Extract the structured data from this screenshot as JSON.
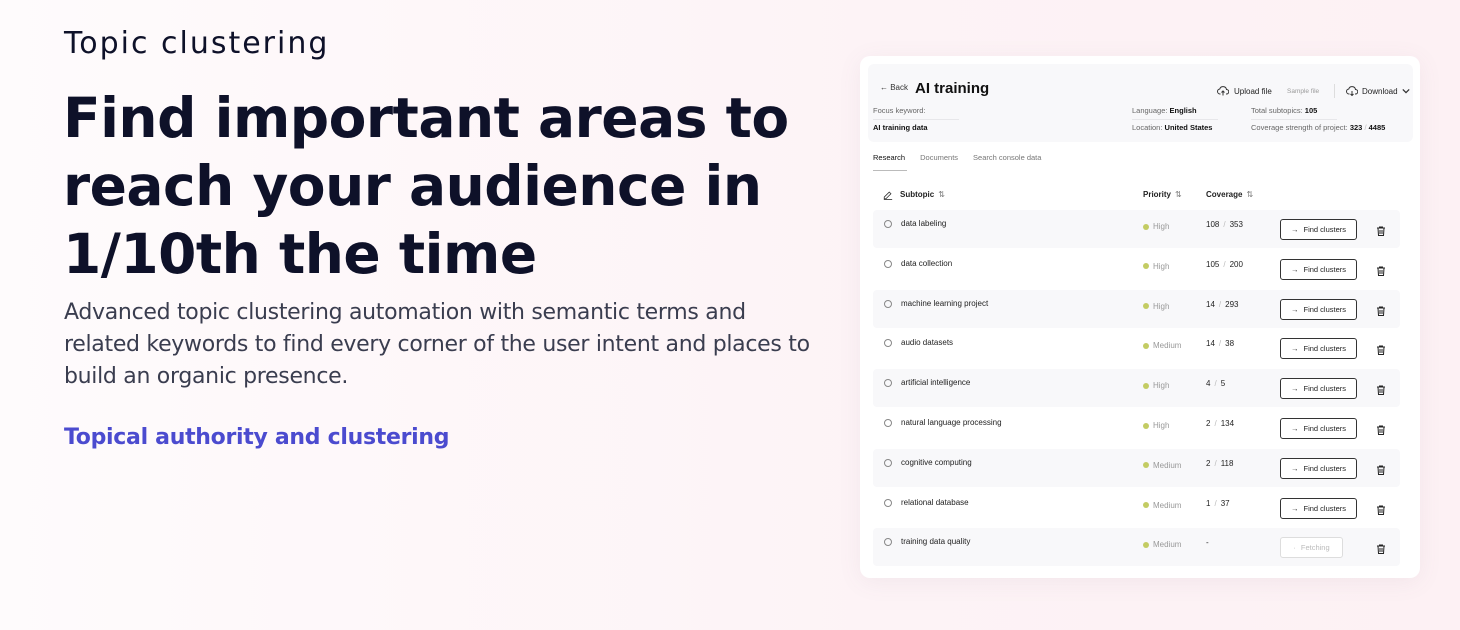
{
  "hero": {
    "eyebrow": "Topic clustering",
    "headline": "Find important areas to reach your audience in 1/10th the time",
    "description": "Advanced topic clustering automation with semantic terms and related keywords to find every corner of the user intent and places to build an organic presence.",
    "link_label": "Topical authority and clustering",
    "link_color": "#4b4bcf"
  },
  "panel": {
    "back_label": "← Back",
    "title": "AI training",
    "upload_label": "Upload file",
    "sample_label": "Sample file",
    "download_label": "Download",
    "focus_keyword_label": "Focus keyword:",
    "focus_keyword_value": "AI training data",
    "language_label": "Language:",
    "language_value": "English",
    "location_label": "Location:",
    "location_value": "United States",
    "total_subtopics_label": "Total subtopics:",
    "total_subtopics_value": "105",
    "coverage_label": "Coverage strength of project:",
    "coverage_value_a": "323",
    "coverage_value_b": "4485",
    "tabs": [
      "Research",
      "Documents",
      "Search console data"
    ],
    "columns": {
      "subtopic": "Subtopic",
      "priority": "Priority",
      "coverage": "Coverage"
    },
    "find_label": "Find clusters",
    "fetching_label": "Fetching",
    "rows": [
      {
        "name": "data labeling",
        "priority": "High",
        "cov_a": "108",
        "cov_b": "353"
      },
      {
        "name": "data collection",
        "priority": "High",
        "cov_a": "105",
        "cov_b": "200"
      },
      {
        "name": "machine learning project",
        "priority": "High",
        "cov_a": "14",
        "cov_b": "293"
      },
      {
        "name": "audio datasets",
        "priority": "Medium",
        "cov_a": "14",
        "cov_b": "38"
      },
      {
        "name": "artificial intelligence",
        "priority": "High",
        "cov_a": "4",
        "cov_b": "5"
      },
      {
        "name": "natural language processing",
        "priority": "High",
        "cov_a": "2",
        "cov_b": "134"
      },
      {
        "name": "cognitive computing",
        "priority": "Medium",
        "cov_a": "2",
        "cov_b": "118"
      },
      {
        "name": "relational database",
        "priority": "Medium",
        "cov_a": "1",
        "cov_b": "37"
      },
      {
        "name": "training data quality",
        "priority": "Medium",
        "cov_a": "-",
        "cov_b": ""
      }
    ]
  }
}
